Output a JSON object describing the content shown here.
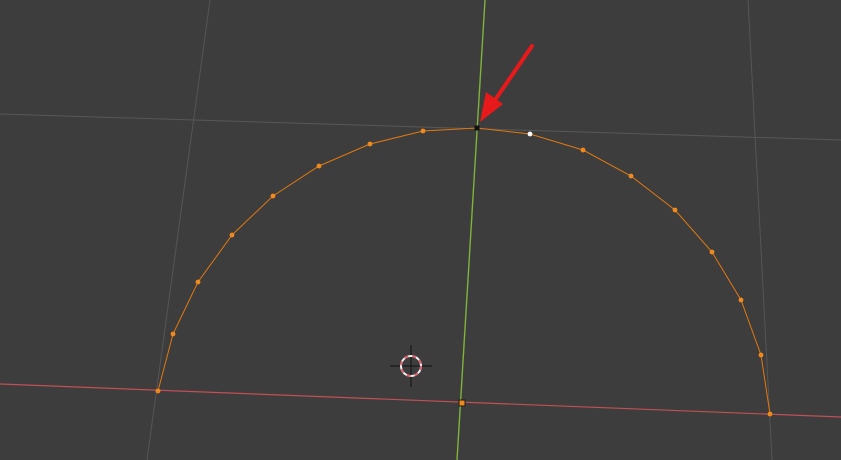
{
  "viewport": {
    "background": "#3d3d3d",
    "colors": {
      "grid": "#585858",
      "x_axis": "#c05055",
      "y_axis": "#7fb33a",
      "curve": "#e07810",
      "vertex": "#f08a1c",
      "active_vertex": "#ffffff",
      "pointer": "#e8191b",
      "cursor_ring_a": "#e06070",
      "cursor_ring_b": "#f0f0f0"
    },
    "icons": {
      "cursor": "3d-cursor-icon",
      "pointer": "red-arrow-annotation"
    }
  }
}
